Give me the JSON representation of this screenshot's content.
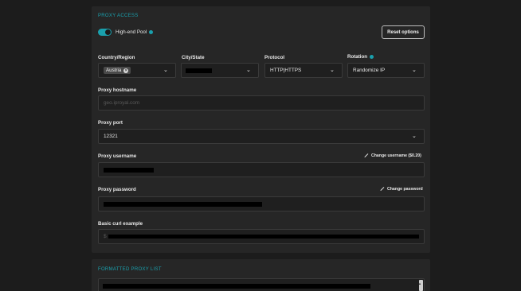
{
  "proxy_access": {
    "section_title": "PROXY ACCESS",
    "pool_label": "High-end Pool",
    "pool_enabled": true,
    "reset_label": "Reset options",
    "country_label": "Country/Region",
    "country_value": "Austria",
    "city_label": "City/State",
    "protocol_label": "Protocol",
    "protocol_value": "HTTP|HTTPS",
    "rotation_label": "Rotation",
    "rotation_value": "Randomize IP",
    "hostname_label": "Proxy hostname",
    "hostname_placeholder": "geo.iproyal.com",
    "port_label": "Proxy port",
    "port_value": "12321",
    "username_label": "Proxy username",
    "change_username_label": "Change username ($0.20)",
    "password_label": "Proxy password",
    "change_password_label": "Change password",
    "curl_label": "Basic curl example",
    "curl_prefix": "$"
  },
  "formatted_list": {
    "section_title": "FORMATTED PROXY LIST"
  },
  "colors": {
    "accent": "#1aa0ad",
    "panel": "#262626",
    "background": "#1c1c1c"
  }
}
